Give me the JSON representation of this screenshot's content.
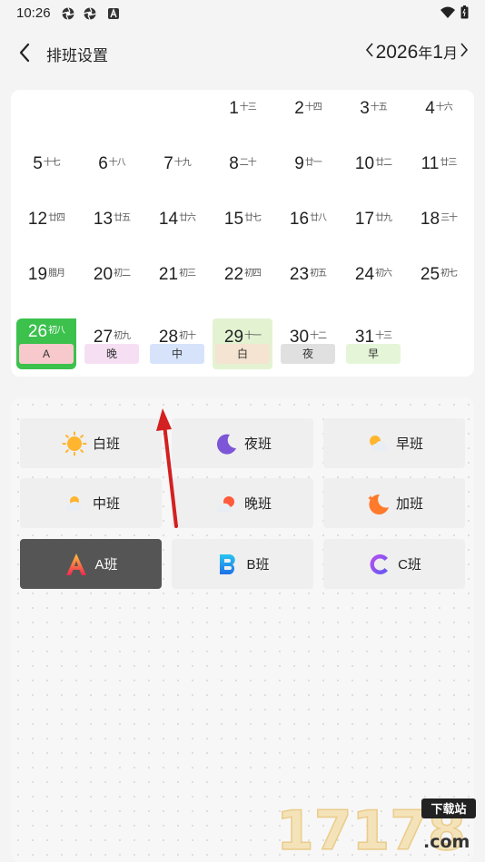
{
  "status_bar": {
    "time": "10:26"
  },
  "header": {
    "title": "排班设置",
    "year": "2026",
    "year_char": "年",
    "month": "1",
    "month_char": "月"
  },
  "calendar": {
    "days": [
      {
        "d": "1",
        "lunar": "十三",
        "row": 0,
        "col": 3
      },
      {
        "d": "2",
        "lunar": "十四",
        "row": 0,
        "col": 4
      },
      {
        "d": "3",
        "lunar": "十五",
        "row": 0,
        "col": 5
      },
      {
        "d": "4",
        "lunar": "十六",
        "row": 0,
        "col": 6
      },
      {
        "d": "5",
        "lunar": "十七",
        "row": 1,
        "col": 0
      },
      {
        "d": "6",
        "lunar": "十八",
        "row": 1,
        "col": 1
      },
      {
        "d": "7",
        "lunar": "十九",
        "row": 1,
        "col": 2
      },
      {
        "d": "8",
        "lunar": "二十",
        "row": 1,
        "col": 3
      },
      {
        "d": "9",
        "lunar": "廿一",
        "row": 1,
        "col": 4
      },
      {
        "d": "10",
        "lunar": "廿二",
        "row": 1,
        "col": 5
      },
      {
        "d": "11",
        "lunar": "廿三",
        "row": 1,
        "col": 6
      },
      {
        "d": "12",
        "lunar": "廿四",
        "row": 2,
        "col": 0
      },
      {
        "d": "13",
        "lunar": "廿五",
        "row": 2,
        "col": 1
      },
      {
        "d": "14",
        "lunar": "廿六",
        "row": 2,
        "col": 2
      },
      {
        "d": "15",
        "lunar": "廿七",
        "row": 2,
        "col": 3
      },
      {
        "d": "16",
        "lunar": "廿八",
        "row": 2,
        "col": 4
      },
      {
        "d": "17",
        "lunar": "廿九",
        "row": 2,
        "col": 5
      },
      {
        "d": "18",
        "lunar": "三十",
        "row": 2,
        "col": 6
      },
      {
        "d": "19",
        "lunar": "腊月",
        "row": 3,
        "col": 0
      },
      {
        "d": "20",
        "lunar": "初二",
        "row": 3,
        "col": 1
      },
      {
        "d": "21",
        "lunar": "初三",
        "row": 3,
        "col": 2
      },
      {
        "d": "22",
        "lunar": "初四",
        "row": 3,
        "col": 3
      },
      {
        "d": "23",
        "lunar": "初五",
        "row": 3,
        "col": 4
      },
      {
        "d": "24",
        "lunar": "初六",
        "row": 3,
        "col": 5
      },
      {
        "d": "25",
        "lunar": "初七",
        "row": 3,
        "col": 6
      },
      {
        "d": "26",
        "lunar": "初八",
        "row": 4,
        "col": 0,
        "tag": "A",
        "tag_color": "#f7c9cc",
        "selected": true
      },
      {
        "d": "27",
        "lunar": "初九",
        "row": 4,
        "col": 1,
        "tag": "晚",
        "tag_color": "#f6dff3"
      },
      {
        "d": "28",
        "lunar": "初十",
        "row": 4,
        "col": 2,
        "tag": "中",
        "tag_color": "#d6e3fb"
      },
      {
        "d": "29",
        "lunar": "十一",
        "row": 4,
        "col": 3,
        "tag": "白",
        "tag_color": "#f5e4d2",
        "highlight": true
      },
      {
        "d": "30",
        "lunar": "十二",
        "row": 4,
        "col": 4,
        "tag": "夜",
        "tag_color": "#e0e0e0"
      },
      {
        "d": "31",
        "lunar": "十三",
        "row": 4,
        "col": 5,
        "tag": "早",
        "tag_color": "#e5f6d8"
      }
    ]
  },
  "shifts": [
    {
      "label": "白班",
      "icon": "sun-icon",
      "row": 0,
      "col": 0
    },
    {
      "label": "夜班",
      "icon": "moon-icon",
      "row": 0,
      "col": 1
    },
    {
      "label": "早班",
      "icon": "sun-cloud-icon",
      "row": 0,
      "col": 2
    },
    {
      "label": "中班",
      "icon": "cloud-sun-icon",
      "row": 1,
      "col": 0
    },
    {
      "label": "晚班",
      "icon": "cloud-sunset-icon",
      "row": 1,
      "col": 1
    },
    {
      "label": "加班",
      "icon": "moon-stars-icon",
      "row": 1,
      "col": 2
    },
    {
      "label": "A班",
      "icon": "letter-a-icon",
      "row": 2,
      "col": 0,
      "active": true
    },
    {
      "label": "B班",
      "icon": "letter-b-icon",
      "row": 2,
      "col": 1
    },
    {
      "label": "C班",
      "icon": "letter-c-icon",
      "row": 2,
      "col": 2
    }
  ],
  "watermark": {
    "text": "17178",
    "sub": "下载站",
    "domain": ".com"
  }
}
